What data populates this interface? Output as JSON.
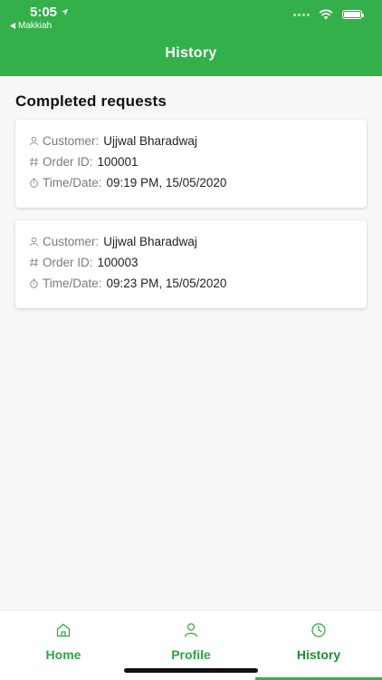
{
  "status_bar": {
    "time": "5:05",
    "back_app": "Makkiah"
  },
  "header": {
    "title": "History"
  },
  "section": {
    "title": "Completed requests"
  },
  "labels": {
    "customer": "Customer:",
    "order_id": "Order ID:",
    "time_date": "Time/Date:"
  },
  "requests": [
    {
      "customer": "Ujjwal Bharadwaj",
      "order_id": "100001",
      "time_date": "09:19 PM, 15/05/2020"
    },
    {
      "customer": "Ujjwal Bharadwaj",
      "order_id": "100003",
      "time_date": "09:23 PM, 15/05/2020"
    }
  ],
  "tabbar": {
    "tabs": [
      {
        "label": "Home",
        "icon": "home-icon"
      },
      {
        "label": "Profile",
        "icon": "person-icon"
      },
      {
        "label": "History",
        "icon": "clock-icon"
      }
    ],
    "active": "History"
  },
  "colors": {
    "brand": "#34b04a",
    "tab_label": "#2ea445"
  }
}
